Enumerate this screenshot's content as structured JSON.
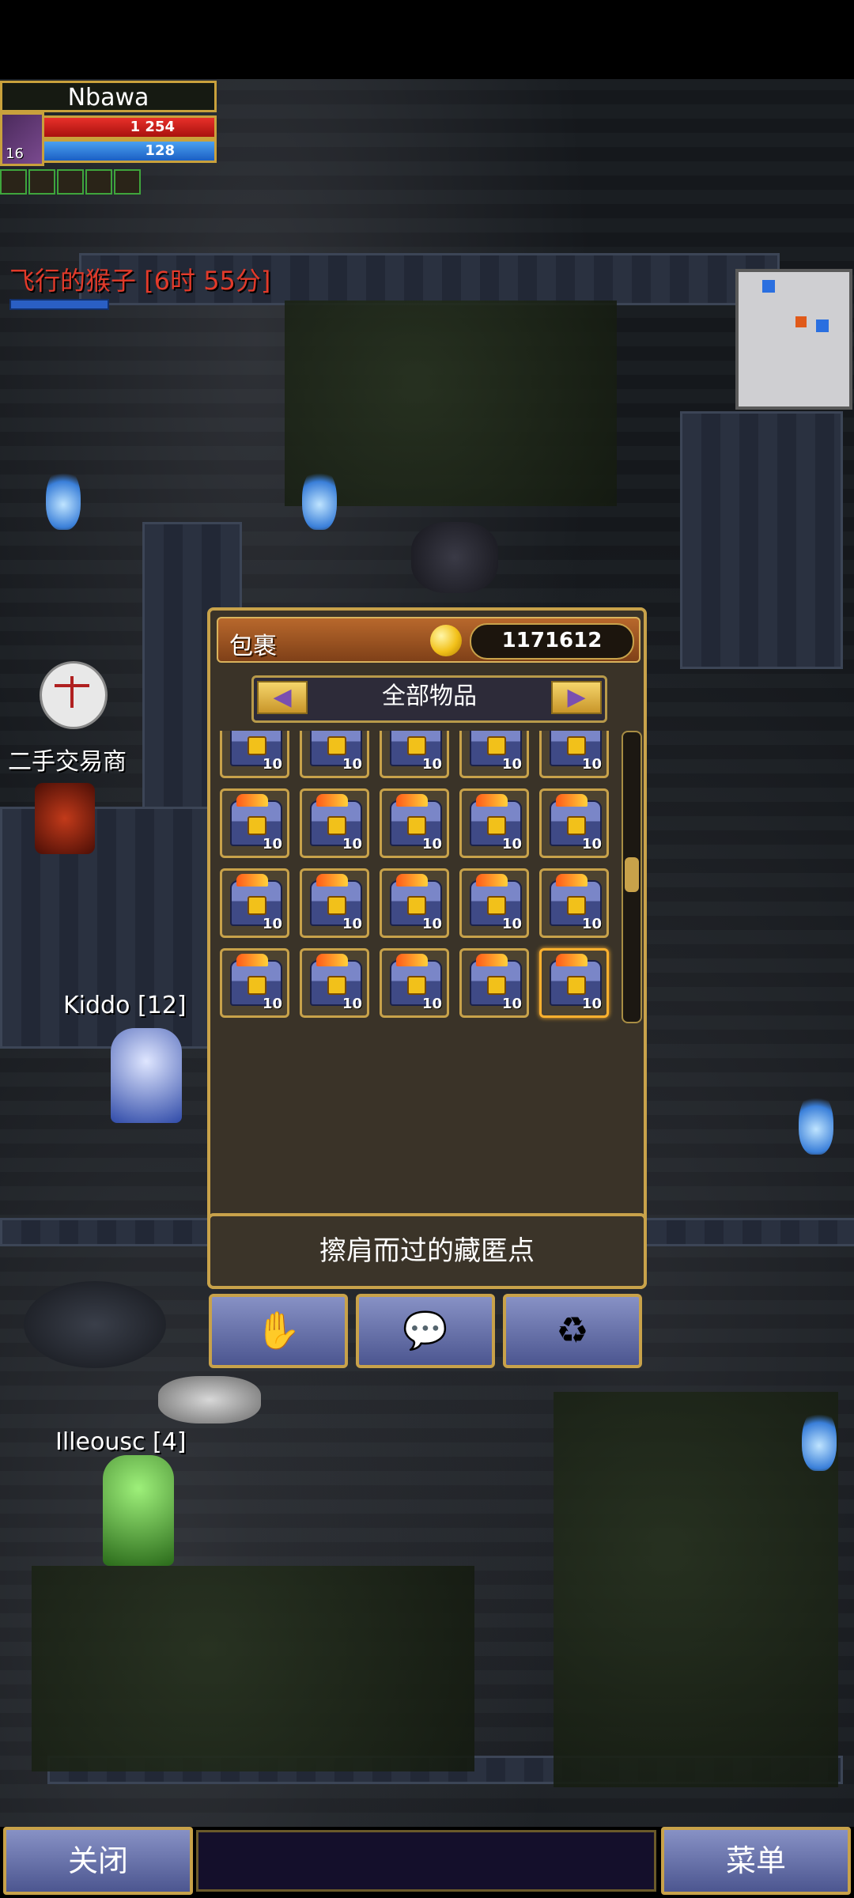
{
  "player": {
    "name": "Nbawa",
    "level": "16",
    "hp": "1 254",
    "mp": "128"
  },
  "target": {
    "label": "飞行的猴子 [6时 55分]"
  },
  "npcs": {
    "trader": "二手交易商",
    "kiddo": "Kiddo [12]",
    "illeousc": "Illeousc [4]"
  },
  "inventory": {
    "title": "包裹",
    "gold": "1171612",
    "filter_label": "全部物品",
    "item_quantity": "10",
    "description": "擦肩而过的藏匿点",
    "action_icons": [
      "hand-icon",
      "speech-bubble-arrow-icon",
      "recycle-bin-icon"
    ]
  },
  "bottom": {
    "close_label": "关闭",
    "menu_label": "菜单"
  },
  "colors": {
    "gold_border": "#c8a24a",
    "button_blue": "#6a74b0",
    "target_red": "#e23a2a",
    "selected_border": "#ffb12e"
  }
}
